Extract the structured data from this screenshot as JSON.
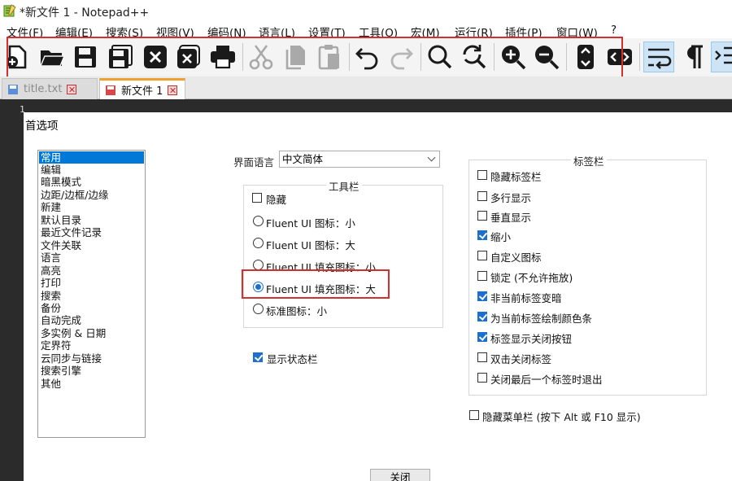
{
  "window": {
    "title": "*新文件 1 - Notepad++"
  },
  "menu": [
    "文件(F)",
    "编辑(E)",
    "搜索(S)",
    "视图(V)",
    "编码(N)",
    "语言(L)",
    "设置(T)",
    "工具(O)",
    "宏(M)",
    "运行(R)",
    "插件(P)",
    "窗口(W)",
    "?"
  ],
  "toolbar": {
    "buttons": [
      "new-file-icon",
      "open-folder-icon",
      "save-icon",
      "save-all-icon",
      "close-icon",
      "close-all-icon",
      "print-icon",
      "cut-icon",
      "copy-icon",
      "paste-icon",
      "undo-icon",
      "redo-icon",
      "find-icon",
      "replace-icon",
      "zoom-in-icon",
      "zoom-out-icon",
      "sync-vertical-icon",
      "sync-horizontal-icon",
      "word-wrap-icon",
      "show-all-chars-icon",
      "indent-guide-icon"
    ],
    "highlight_color": "#d32f2f"
  },
  "tabs": [
    {
      "label": "title.txt",
      "active": false
    },
    {
      "label": "新文件 1",
      "active": true
    }
  ],
  "editor": {
    "line_number": "1"
  },
  "dialog": {
    "title": "首选项",
    "categories": [
      "常用",
      "编辑",
      "暗黑模式",
      "边距/边框/边缘",
      "新建",
      "默认目录",
      "最近文件记录",
      "文件关联",
      "语言",
      "高亮",
      "打印",
      "搜索",
      "备份",
      "自动完成",
      "多实例 & 日期",
      "定界符",
      "云同步与链接",
      "搜索引擎",
      "其他"
    ],
    "selected_category": "常用",
    "language_label": "界面语言",
    "language_value": "中文简体",
    "toolbar_group": {
      "title": "工具栏",
      "hide_label": "隐藏",
      "options": [
        "Fluent UI 图标：小",
        "Fluent UI 图标：大",
        "Fluent UI 填充图标：小",
        "Fluent UI 填充图标：大",
        "标准图标：小"
      ],
      "selected_index": 3
    },
    "status_bar_label": "显示状态栏",
    "tabbar_group": {
      "title": "标签栏",
      "options": [
        {
          "label": "隐藏标签栏",
          "checked": false
        },
        {
          "label": "多行显示",
          "checked": false
        },
        {
          "label": "垂直显示",
          "checked": false
        },
        {
          "label": "缩小",
          "checked": true
        },
        {
          "label": "自定义图标",
          "checked": false
        },
        {
          "label": "锁定 (不允许拖放)",
          "checked": false
        },
        {
          "label": "非当前标签变暗",
          "checked": true
        },
        {
          "label": "为当前标签绘制颜色条",
          "checked": true
        },
        {
          "label": "标签显示关闭按钮",
          "checked": true
        },
        {
          "label": "双击关闭标签",
          "checked": false
        },
        {
          "label": "关闭最后一个标签时退出",
          "checked": false
        }
      ]
    },
    "hide_menubar_label": "隐藏菜单栏 (按下 Alt 或 F10 显示)",
    "close_button": "关闭"
  }
}
